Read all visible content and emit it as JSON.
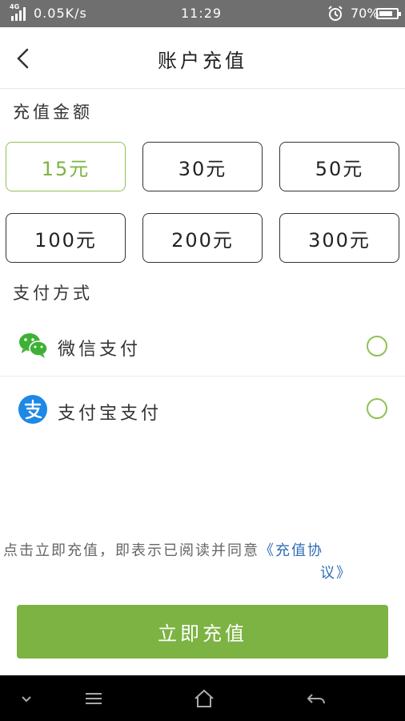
{
  "status_bar": {
    "network": "4G",
    "speed": "0.05K/s",
    "time": "11:29",
    "battery_pct": "70%"
  },
  "header": {
    "title": "账户充值",
    "back_icon": "chevron-left-icon"
  },
  "amount_section": {
    "label": "充值金额",
    "options": [
      {
        "label": "15元",
        "selected": true
      },
      {
        "label": "30元",
        "selected": false
      },
      {
        "label": "50元",
        "selected": false
      },
      {
        "label": "100元",
        "selected": false
      },
      {
        "label": "200元",
        "selected": false
      },
      {
        "label": "300元",
        "selected": false
      }
    ]
  },
  "payment_section": {
    "label": "支付方式",
    "methods": [
      {
        "label": "微信支付",
        "icon": "wechat-icon",
        "selected": false
      },
      {
        "label": "支付宝支付",
        "icon": "alipay-icon",
        "selected": false
      }
    ]
  },
  "agreement": {
    "text": "点击立即充值，即表示已阅读并同意",
    "link_part1": "《充值协",
    "link_part2": "议》"
  },
  "submit": {
    "label": "立即充值"
  },
  "colors": {
    "accent": "#7cb342",
    "link": "#2f6db5",
    "status_bar": "#6f6f6f"
  }
}
